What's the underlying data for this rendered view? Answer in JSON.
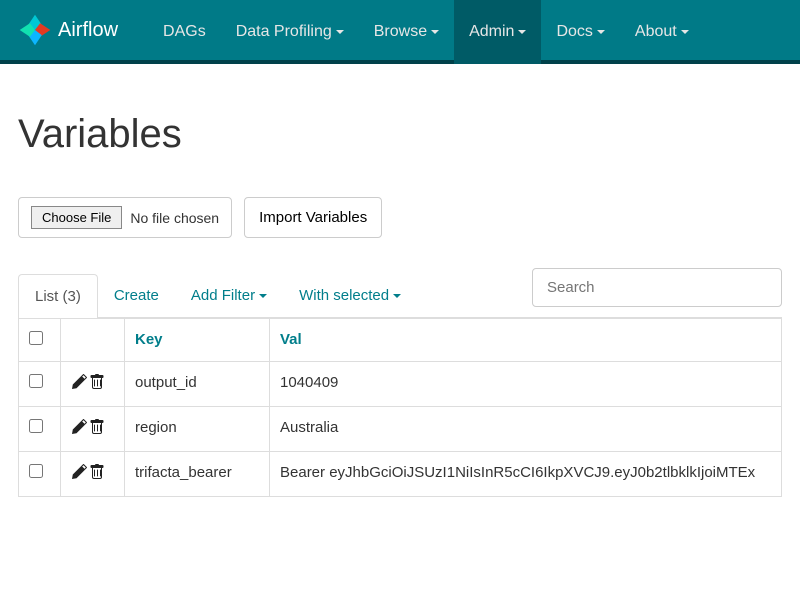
{
  "brand": "Airflow",
  "nav": {
    "dags": "DAGs",
    "data_profiling": "Data Profiling",
    "browse": "Browse",
    "admin": "Admin",
    "docs": "Docs",
    "about": "About"
  },
  "page_title": "Variables",
  "file_upload": {
    "choose_label": "Choose File",
    "status": "No file chosen",
    "import_label": "Import Variables"
  },
  "actions": {
    "list_label": "List (3)",
    "create": "Create",
    "add_filter": "Add Filter",
    "with_selected": "With selected",
    "search_placeholder": "Search"
  },
  "columns": {
    "key": "Key",
    "val": "Val"
  },
  "rows": [
    {
      "key": "output_id",
      "val": "1040409"
    },
    {
      "key": "region",
      "val": "Australia"
    },
    {
      "key": "trifacta_bearer",
      "val": "Bearer eyJhbGciOiJSUzI1NiIsInR5cCI6IkpXVCJ9.eyJ0b2tlbklkIjoiMTEx"
    }
  ]
}
